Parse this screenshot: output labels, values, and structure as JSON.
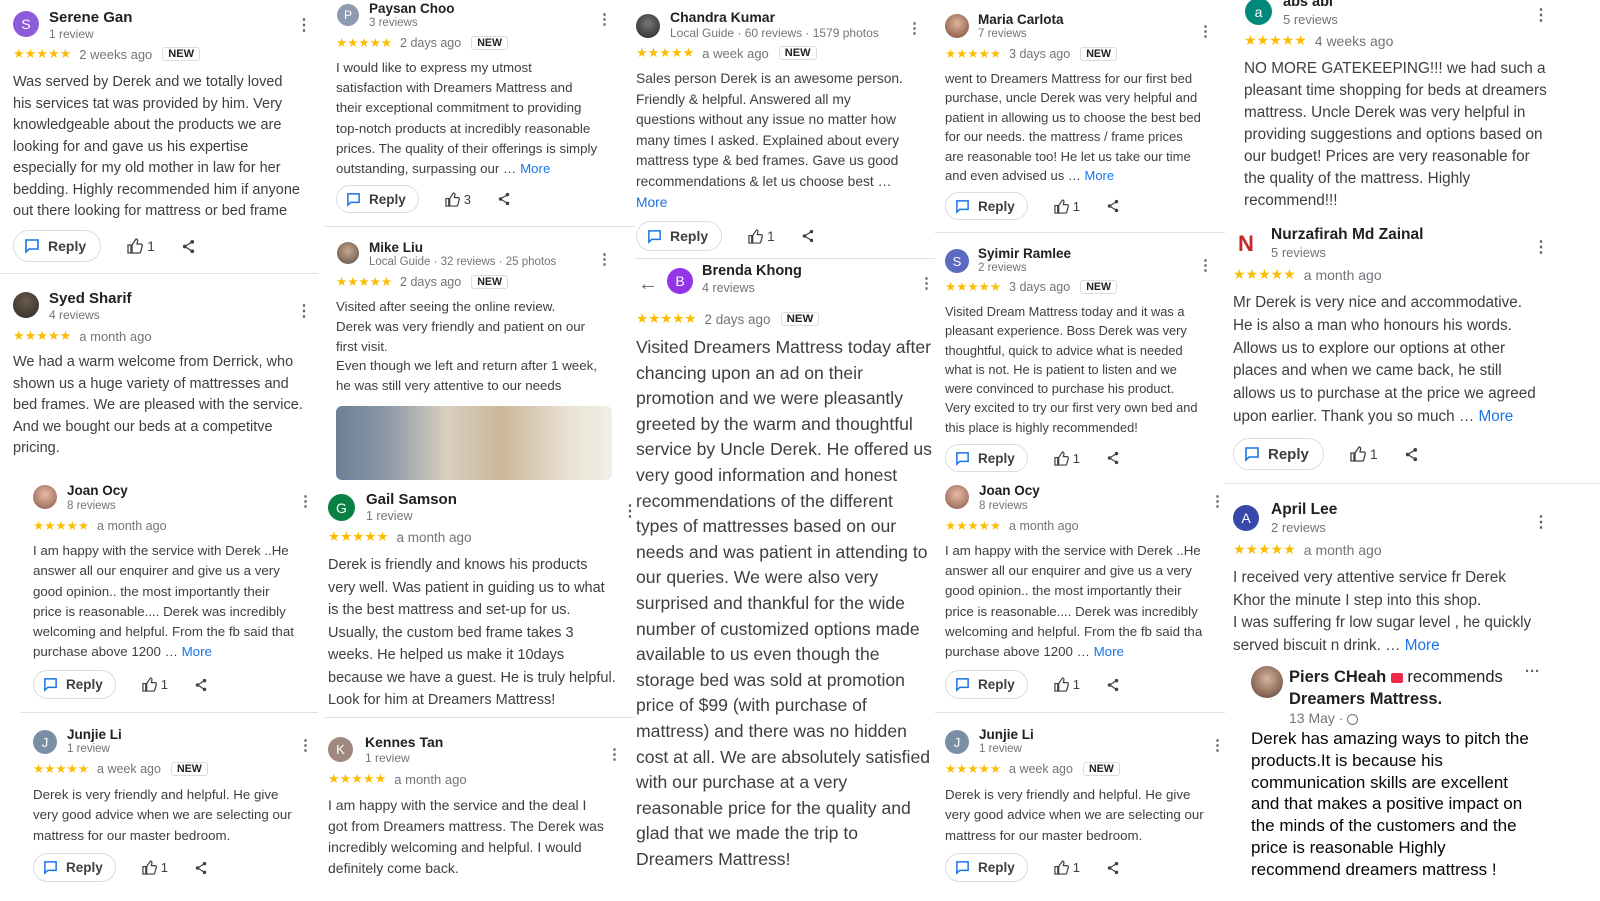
{
  "ui": {
    "reply_label": "Reply",
    "more_label": "More",
    "new_badge": "NEW",
    "stars": "★★★★★",
    "accent": "#1a73e8",
    "star_color": "#fbbc04"
  },
  "col1": {
    "serene": {
      "avatar": "S",
      "avatar_color": "#8e5cd9",
      "name": "Serene Gan",
      "sub": "1 review",
      "time": "2 weeks ago",
      "text": "Was served by Derek and we totally loved\nhis services tat was provided by him. Very\nknowledgeable about the products we are\nlooking for and gave us his expertise\nespecially for my old mother in law for her\nbedding. Highly recommended him if anyone\nout there looking for mattress or bed frame",
      "likes": "1"
    },
    "syed": {
      "name": "Syed Sharif",
      "sub": "4 reviews",
      "time": "a month ago",
      "text": "We had a warm welcome from Derrick, who\nshown us a huge variety of mattresses and\nbed frames. We are pleased with the service.\nAnd we bought our beds at a competitve\npricing."
    },
    "joan": {
      "name": "Joan Ocy",
      "sub": "8 reviews",
      "time": "a month ago",
      "text": "I am happy with the service with Derek ..He\nanswer all our enquirer and give us a very\ngood opinion.. the most importantly their\nprice is reasonable.... Derek was incredibly\nwelcoming and helpful. From the fb said that\npurchase above 1200 …",
      "likes": "1"
    },
    "junjie": {
      "avatar": "J",
      "avatar_color": "#7a8fa6",
      "name": "Junjie Li",
      "sub": "1 review",
      "time": "a week ago",
      "text": "Derek is very friendly and helpful. He give\nvery good advice when we are selecting our\nmattress for our master bedroom.",
      "likes": "1"
    }
  },
  "col2": {
    "paysan": {
      "avatar": "P",
      "avatar_color": "#8d9bb0",
      "name": "Paysan Choo",
      "sub": "3 reviews",
      "time": "2 days ago",
      "text": "I would like to express my utmost\nsatisfaction with Dreamers Mattress and\ntheir exceptional commitment to providing\ntop-notch products at incredibly reasonable\nprices. The quality of their offerings is simply\noutstanding, surpassing our …",
      "likes": "3"
    },
    "mike": {
      "name": "Mike Liu",
      "sub": "Local Guide · 32 reviews · 25 photos",
      "time": "2 days ago",
      "text": "Visited after seeing the online review.\nDerek was very friendly and patient on our\nfirst visit.\nEven though we left and return after 1 week,\nhe was still very attentive to our needs"
    },
    "gail": {
      "avatar": "G",
      "avatar_color": "#0b8043",
      "name": "Gail Samson",
      "sub": "1 review",
      "time": "a month ago",
      "text": "Derek is friendly and knows his products\nvery well. Was patient in guiding us to what\nis the best mattress and set-up for us.\nUsually, the custom bed frame takes 3\nweeks. He helped us make it 10days\nbecause we have a guest. He is truly helpful.\nLook for him at Dreamers Mattress!"
    },
    "kennes": {
      "avatar": "K",
      "avatar_color": "#a1887f",
      "name": "Kennes Tan",
      "sub": "1 review",
      "time": "a month ago",
      "text": "I am happy with the service and the deal I\ngot from Dreamers mattress. The Derek was\nincredibly welcoming and helpful. I would\ndefinitely come back."
    }
  },
  "col3": {
    "chandra": {
      "name": "Chandra Kumar",
      "sub": "Local Guide · 60 reviews · 1579 photos",
      "time": "a week ago",
      "text": "Sales person Derek is an awesome person.\nFriendly & helpful. Answered all my\nquestions without any issue no matter how\nmany times I asked. Explained about every\nmattress type & bed frames. Gave us good\nrecommendations & let us choose best …",
      "likes": "1"
    },
    "brenda": {
      "avatar": "B",
      "avatar_color": "#9334e6",
      "name": "Brenda Khong",
      "sub": "4 reviews",
      "time": "2 days ago",
      "text": "Visited Dreamers Mattress today after\nchancing upon an ad on their\npromotion and we were pleasantly\ngreeted by the warm and thoughtful\nservice by Uncle Derek. He offered us\nvery good information and honest\nrecommendations of the different\ntypes of mattresses based on our\nneeds and was patient in attending to\nour queries. We were also very\nsurprised and thankful for the wide\nnumber of customized options made\navailable to us even though the\nstorage bed was sold at promotion\nprice of $99 (with purchase of\nmattress) and there was no hidden\ncost at all. We are absolutely satisfied\nwith our purchase at a very\nreasonable price for the quality and\nglad that we made the trip to\nDreamers Mattress!"
    }
  },
  "col4": {
    "maria": {
      "name": "Maria Carlota",
      "sub": "7 reviews",
      "time": "3 days ago",
      "text": "went to Dreamers Mattress for our first bed\npurchase, uncle Derek was very helpful and\npatient in allowing us to choose the best bed\nfor our needs. the mattress / frame prices\nare reasonable too! He let us take our time\nand even advised us …",
      "likes": "1"
    },
    "syimir": {
      "avatar": "S",
      "avatar_color": "#5c6bc0",
      "name": "Syimir Ramlee",
      "sub": "2 reviews",
      "time": "3 days ago",
      "text": "Visited Dream Mattress today and it was a\npleasant experience. Boss Derek was very\nthoughtful, quick to advice what is needed\nwhat is not. He is patient to listen and we\nwere convinced to purchase his product.\nVery excited to try our first very own bed and\nthis place is highly recommended!",
      "likes": "1"
    },
    "joan": {
      "name": "Joan Ocy",
      "sub": "8 reviews",
      "time": "a month ago",
      "text": "I am happy with the service with Derek ..He\nanswer all our enquirer and give us a very\ngood opinion.. the most importantly their\nprice is reasonable.... Derek was incredibly\nwelcoming and helpful. From the fb said tha\npurchase above 1200 …",
      "likes": "1"
    },
    "junjie": {
      "avatar": "J",
      "avatar_color": "#7a8fa6",
      "name": "Junjie Li",
      "sub": "1 review",
      "time": "a week ago",
      "text": "Derek is very friendly and helpful. He give\nvery good advice when we are selecting our\nmattress for our master bedroom.",
      "likes": "1"
    }
  },
  "col5": {
    "absabi": {
      "avatar": "a",
      "avatar_color": "#00897b",
      "name": "abs abi",
      "sub": "5 reviews",
      "time": "4 weeks ago",
      "text": "NO MORE GATEKEEPING!!! we had such a\npleasant time shopping for beds at dreamers\nmattress. Uncle Derek was very helpful in\nproviding suggestions and options based on\nour budget! Prices are very reasonable for\nthe quality of the mattress. Highly\nrecommend!!!"
    },
    "nurz": {
      "avatar": "N",
      "avatar_color": "#c62828",
      "name": "Nurzafirah Md Zainal",
      "sub": "5 reviews",
      "time": "a month ago",
      "text": "Mr Derek is very nice and accommodative.\nHe is also a man who honours his words.\nAllows us to explore our options at other\nplaces and when we came back, he still\nallows us to purchase at the price we agreed\nupon earlier. Thank you so much …",
      "likes": "1"
    },
    "april": {
      "avatar": "A",
      "avatar_color": "#3949ab",
      "name": "April Lee",
      "sub": "2 reviews",
      "time": "a month ago",
      "text": "I received very attentive service fr Derek\nKhor the minute I step into this shop.\nI was suffering fr low sugar level , he quickly\nserved biscuit n drink. …"
    },
    "piers": {
      "name": "Piers CHeah",
      "recommends": "recommends",
      "page": "Dreamers Mattress.",
      "date": "13 May ·",
      "text": "Derek has amazing ways to pitch the\nproducts.It is because his\ncommunication skills are excellent\nand that makes a positive impact on\nthe minds of the customers and the\nprice is reasonable Highly\nrecommend dreamers mattress !"
    }
  }
}
